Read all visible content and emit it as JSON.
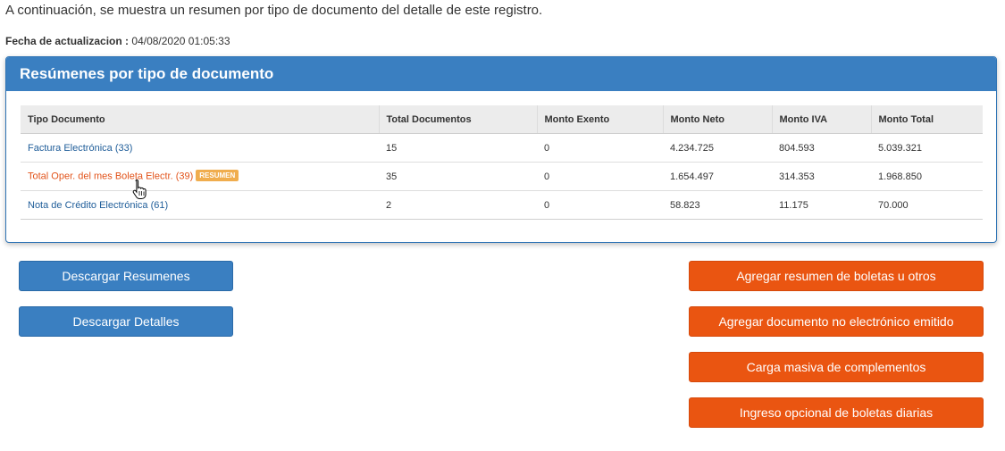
{
  "intro_text": "A continuación, se muestra un resumen por tipo de documento del detalle de este registro.",
  "update": {
    "label": "Fecha de actualizacion :",
    "value": "04/08/2020 01:05:33"
  },
  "panel": {
    "title": "Resúmenes por tipo de documento"
  },
  "table": {
    "headers": [
      "Tipo Documento",
      "Total Documentos",
      "Monto Exento",
      "Monto Neto",
      "Monto IVA",
      "Monto Total"
    ],
    "rows": [
      {
        "tipo": "Factura Electrónica (33)",
        "total": "15",
        "exento": "0",
        "neto": "4.234.725",
        "iva": "804.593",
        "monto_total": "5.039.321"
      },
      {
        "tipo": "Total Oper. del mes Boleta Electr. (39)",
        "badge": "RESUMEN",
        "total": "35",
        "exento": "0",
        "neto": "1.654.497",
        "iva": "314.353",
        "monto_total": "1.968.850"
      },
      {
        "tipo": "Nota de Crédito Electrónica (61)",
        "total": "2",
        "exento": "0",
        "neto": "58.823",
        "iva": "11.175",
        "monto_total": "70.000"
      }
    ]
  },
  "buttons": {
    "descargar_resumenes": "Descargar Resumenes",
    "descargar_detalles": "Descargar Detalles",
    "agregar_resumen": "Agregar resumen de boletas u otros",
    "agregar_documento": "Agregar documento no electrónico emitido",
    "carga_masiva": "Carga masiva de complementos",
    "ingreso_opcional": "Ingreso opcional de boletas diarias"
  },
  "colors": {
    "primary_blue": "#3a7fc1",
    "action_orange": "#ea5511",
    "link_blue": "#1f5d99",
    "link_orange": "#e2531a",
    "badge": "#f0ad4e"
  },
  "icons": {
    "cursor": "hand-pointer-icon"
  }
}
